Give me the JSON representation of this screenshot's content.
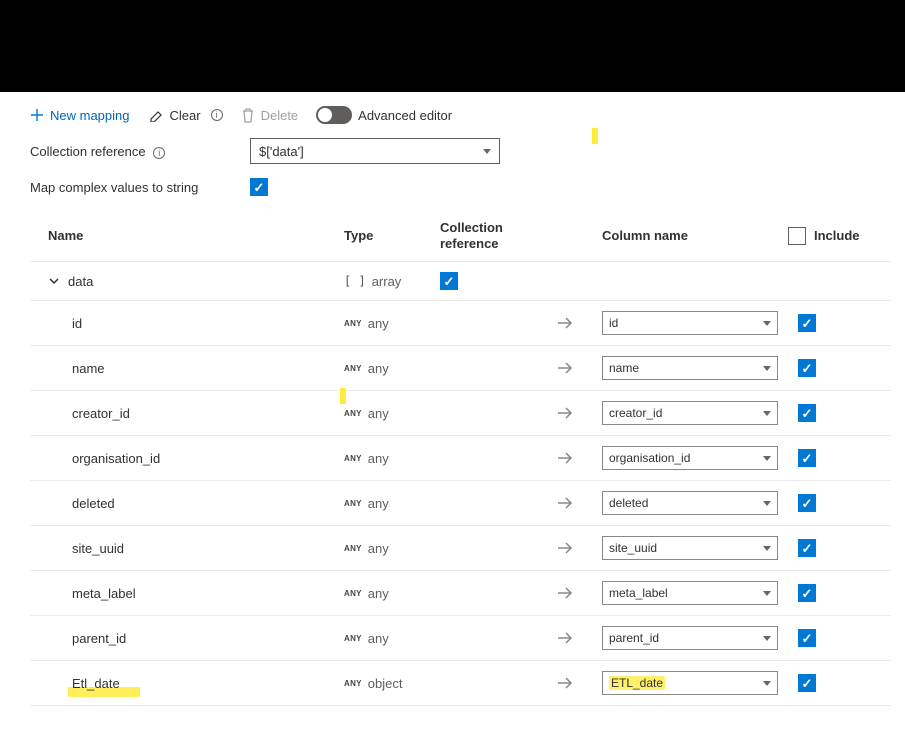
{
  "toolbar": {
    "new_mapping": "New mapping",
    "clear": "Clear",
    "delete": "Delete",
    "advanced_editor": "Advanced editor"
  },
  "collection_reference": {
    "label": "Collection reference",
    "value": "$['data']"
  },
  "map_complex": {
    "label": "Map complex values to string",
    "checked": true
  },
  "columns": {
    "name": "Name",
    "type": "Type",
    "collection_reference": "Collection reference",
    "column_name": "Column name",
    "include": "Include"
  },
  "include_header_checked": false,
  "rows": [
    {
      "name": "data",
      "type_badge": "",
      "type": "array",
      "brackets": "[ ]",
      "is_parent": true,
      "collection_ref_checked": true,
      "column_name": "",
      "include": null,
      "highlight_name": false,
      "highlight_col": false
    },
    {
      "name": "id",
      "type_badge": "ANY",
      "type": "any",
      "is_parent": false,
      "column_name": "id",
      "include": true,
      "highlight_name": false,
      "highlight_col": false
    },
    {
      "name": "name",
      "type_badge": "ANY",
      "type": "any",
      "is_parent": false,
      "column_name": "name",
      "include": true,
      "highlight_name": false,
      "highlight_col": false
    },
    {
      "name": "creator_id",
      "type_badge": "ANY",
      "type": "any",
      "is_parent": false,
      "column_name": "creator_id",
      "include": true,
      "highlight_name": false,
      "highlight_col": false
    },
    {
      "name": "organisation_id",
      "type_badge": "ANY",
      "type": "any",
      "is_parent": false,
      "column_name": "organisation_id",
      "include": true,
      "highlight_name": false,
      "highlight_col": false
    },
    {
      "name": "deleted",
      "type_badge": "ANY",
      "type": "any",
      "is_parent": false,
      "column_name": "deleted",
      "include": true,
      "highlight_name": false,
      "highlight_col": false
    },
    {
      "name": "site_uuid",
      "type_badge": "ANY",
      "type": "any",
      "is_parent": false,
      "column_name": "site_uuid",
      "include": true,
      "highlight_name": false,
      "highlight_col": false
    },
    {
      "name": "meta_label",
      "type_badge": "ANY",
      "type": "any",
      "is_parent": false,
      "column_name": "meta_label",
      "include": true,
      "highlight_name": false,
      "highlight_col": false
    },
    {
      "name": "parent_id",
      "type_badge": "ANY",
      "type": "any",
      "is_parent": false,
      "column_name": "parent_id",
      "include": true,
      "highlight_name": false,
      "highlight_col": false
    },
    {
      "name": "Etl_date",
      "type_badge": "ANY",
      "type": "object",
      "is_parent": false,
      "column_name": "ETL_date",
      "include": true,
      "highlight_name": true,
      "highlight_col": true
    }
  ]
}
